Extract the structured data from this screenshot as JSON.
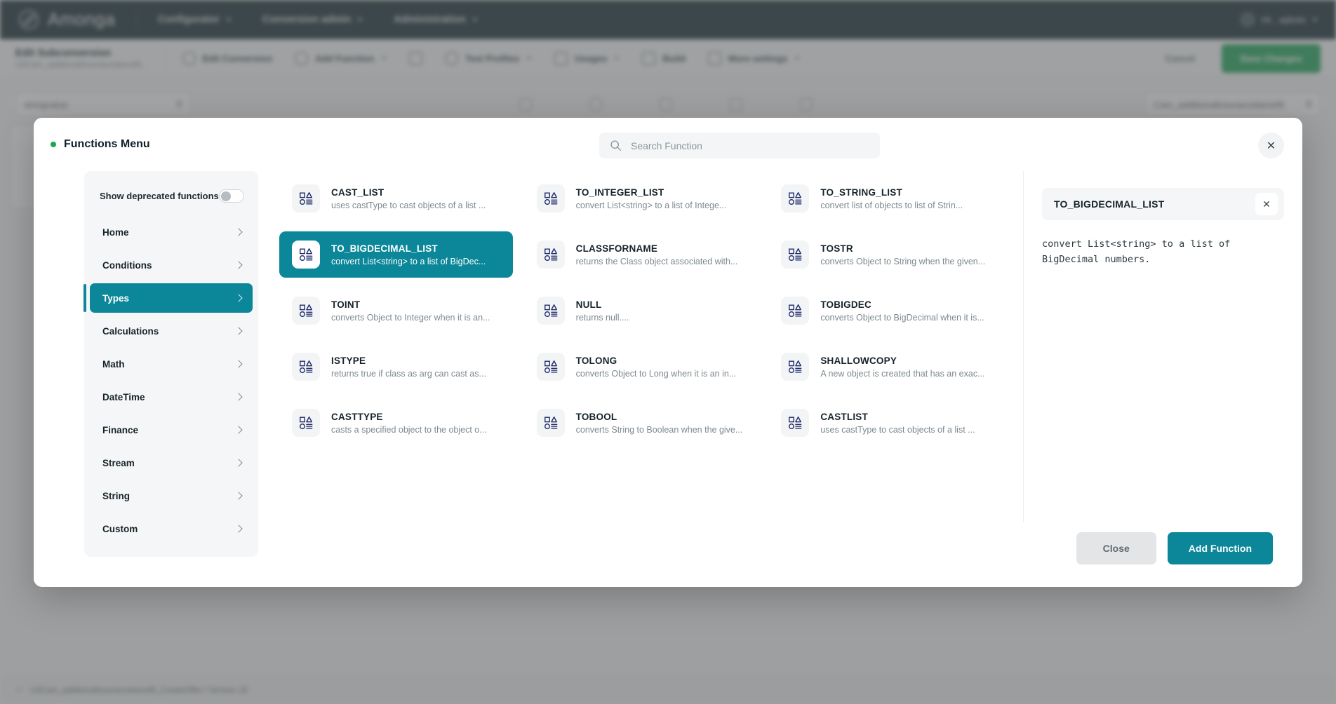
{
  "app": {
    "brand": "Amonga",
    "brand_icon": "amonga-logo-icon",
    "nav": [
      {
        "label": "Configurator",
        "icon": "chevron-down-icon"
      },
      {
        "label": "Conversion admin",
        "icon": "chevron-down-icon"
      },
      {
        "label": "Administration",
        "icon": "chevron-down-icon"
      }
    ],
    "user_menu": {
      "label": "Hi , admin",
      "icon": "user-avatar-icon"
    }
  },
  "subbar": {
    "title": "Edit Subconversion",
    "subtitle": "U3Cam_additionalinsurancebenefit...",
    "items": [
      {
        "label": "Edit Conversion",
        "icon": "edit-conversion-icon"
      },
      {
        "label": "Add Function",
        "icon": "add-function-icon"
      },
      {
        "label": "Test Profiles",
        "icon": "play-icon"
      },
      {
        "label": "Usages",
        "icon": "usages-icon"
      },
      {
        "label": "Build",
        "icon": "build-icon"
      },
      {
        "label": "More settings",
        "icon": "more-settings-icon"
      }
    ],
    "cancel_label": "Cancel",
    "save_label": "Save Changes"
  },
  "workarea": {
    "left_search_value": "stringvalue",
    "right_search_value": "Cam_additionalinsurancebenefit",
    "search_icon": "search-icon"
  },
  "statusbar": {
    "text": "U3Cam_additionalinsurancebenefit_CreateOffer / Version  19",
    "icon": "version-branch-icon"
  },
  "modal": {
    "title": "Functions Menu",
    "status_dot_color": "#16a94e",
    "close_icon": "close-icon",
    "search": {
      "placeholder": "Search Function",
      "value": "",
      "icon": "search-icon"
    },
    "sidebar": {
      "deprecated_toggle_label": "Show deprecated functions",
      "deprecated_toggle_on": false,
      "items": [
        {
          "label": "Home",
          "active": false
        },
        {
          "label": "Conditions",
          "active": false
        },
        {
          "label": "Types",
          "active": true
        },
        {
          "label": "Calculations",
          "active": false
        },
        {
          "label": "Math",
          "active": false
        },
        {
          "label": "DateTime",
          "active": false
        },
        {
          "label": "Finance",
          "active": false
        },
        {
          "label": "Stream",
          "active": false
        },
        {
          "label": "String",
          "active": false
        },
        {
          "label": "Custom",
          "active": false
        }
      ],
      "chevron_icon": "chevron-right-icon"
    },
    "functions": [
      {
        "name": "CAST_LIST",
        "desc": "uses castType to cast objects of a list ...",
        "selected": false,
        "icon": "function-types-icon"
      },
      {
        "name": "TO_INTEGER_LIST",
        "desc": "convert List<string> to a list of Intege...",
        "selected": false,
        "icon": "function-types-icon"
      },
      {
        "name": "TO_STRING_LIST",
        "desc": "convert list of objects to list of Strin...",
        "selected": false,
        "icon": "function-types-icon"
      },
      {
        "name": "TO_BIGDECIMAL_LIST",
        "desc": "convert List<string> to a list of BigDec...",
        "selected": true,
        "icon": "function-types-icon"
      },
      {
        "name": "CLASSFORNAME",
        "desc": "returns the Class object associated with...",
        "selected": false,
        "icon": "function-types-icon"
      },
      {
        "name": "TOSTR",
        "desc": "converts Object to String when the given...",
        "selected": false,
        "icon": "function-types-icon"
      },
      {
        "name": "TOINT",
        "desc": "converts Object to Integer when it is an...",
        "selected": false,
        "icon": "function-types-icon"
      },
      {
        "name": "NULL",
        "desc": "returns null....",
        "selected": false,
        "icon": "function-types-icon"
      },
      {
        "name": "TOBIGDEC",
        "desc": "converts Object to BigDecimal when it is...",
        "selected": false,
        "icon": "function-types-icon"
      },
      {
        "name": "ISTYPE",
        "desc": "returns true if class as arg can cast as...",
        "selected": false,
        "icon": "function-types-icon"
      },
      {
        "name": "TOLONG",
        "desc": "converts Object to Long when it is an in...",
        "selected": false,
        "icon": "function-types-icon"
      },
      {
        "name": "SHALLOWCOPY",
        "desc": "A new object is created that has an exac...",
        "selected": false,
        "icon": "function-types-icon"
      },
      {
        "name": "CASTTYPE",
        "desc": "casts a specified object to the object o...",
        "selected": false,
        "icon": "function-types-icon"
      },
      {
        "name": "TOBOOL",
        "desc": "converts String to Boolean when the give...",
        "selected": false,
        "icon": "function-types-icon"
      },
      {
        "name": "CASTLIST",
        "desc": "uses castType to cast objects of a list ...",
        "selected": false,
        "icon": "function-types-icon"
      }
    ],
    "detail": {
      "title": "TO_BIGDECIMAL_LIST",
      "description": "convert List<string> to a list of BigDecimal numbers.",
      "close_icon": "close-icon"
    },
    "footer": {
      "close_label": "Close",
      "add_label": "Add Function"
    }
  },
  "colors": {
    "accent_teal": "#0b8799",
    "topnav_dark": "#0b2329",
    "save_green": "#12a150"
  }
}
